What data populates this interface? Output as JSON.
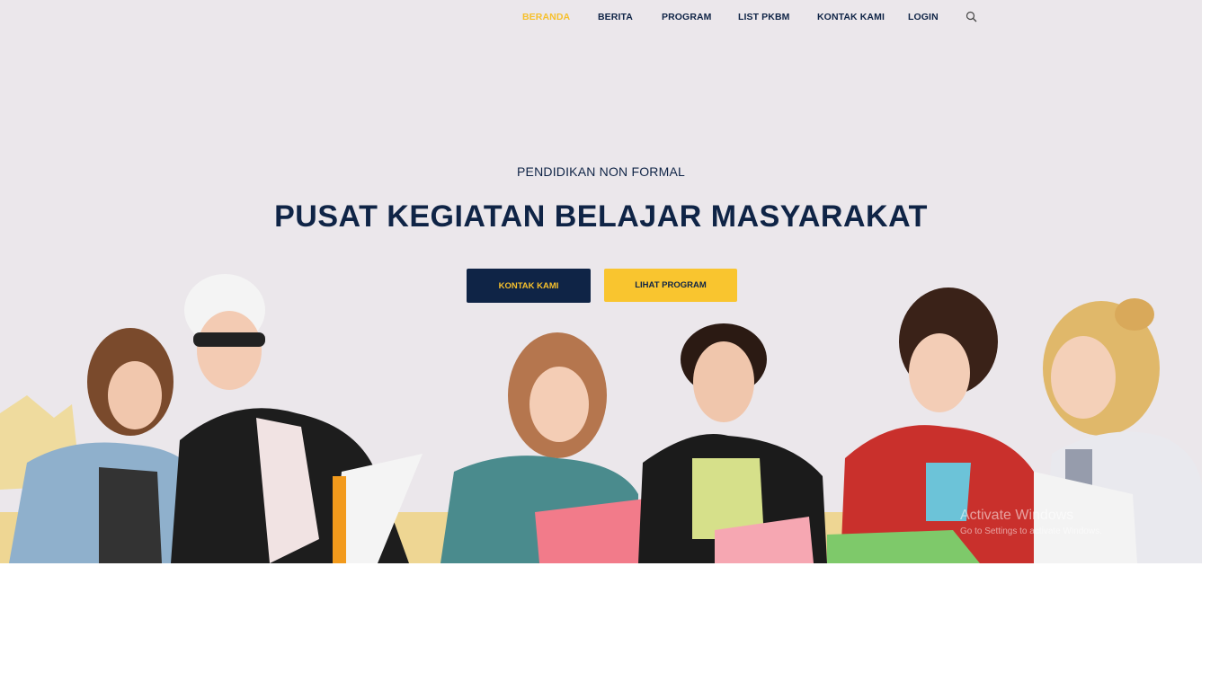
{
  "nav": {
    "items": [
      {
        "label": "BERANDA",
        "active": true
      },
      {
        "label": "BERITA"
      },
      {
        "label": "PROGRAM"
      },
      {
        "label": "LIST PKBM"
      },
      {
        "label": "KONTAK KAMI"
      },
      {
        "label": "LOGIN"
      }
    ],
    "search_icon": "search-icon"
  },
  "hero": {
    "eyebrow": "PENDIDIKAN NON FORMAL",
    "title": "PUSAT KEGIATAN BELAJAR MASYARAKAT",
    "primary_button": "KONTAK KAMI",
    "secondary_button": "LIHAT PROGRAM",
    "image_description_icon": "students-photo"
  },
  "watermark": {
    "title": "Activate Windows",
    "subtitle": "Go to Settings to activate Windows."
  },
  "colors": {
    "navy": "#0f2446",
    "accent_yellow": "#f6c02c",
    "hero_bg": "#ebe7eb"
  }
}
